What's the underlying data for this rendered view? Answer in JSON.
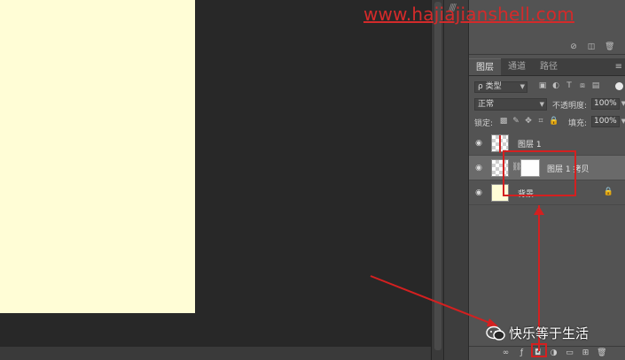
{
  "watermark": "www.hajiajianshell.com",
  "panel_tabs": [
    {
      "label": "图层",
      "active": true
    },
    {
      "label": "通道",
      "active": false
    },
    {
      "label": "路径",
      "active": false
    }
  ],
  "filter": {
    "value": "ρ 类型"
  },
  "blend_mode": {
    "value": "正常"
  },
  "opacity": {
    "label": "不透明度:",
    "value": "100%"
  },
  "lock": {
    "label": "锁定:"
  },
  "fill": {
    "label": "填充:",
    "value": "100%"
  },
  "layers": [
    {
      "name": "图层 1",
      "visible": true,
      "selected": false,
      "has_mask": false,
      "locked": false
    },
    {
      "name": "图层 1 拷贝",
      "visible": true,
      "selected": true,
      "has_mask": true,
      "locked": false
    },
    {
      "name": "背景",
      "visible": true,
      "selected": false,
      "has_mask": false,
      "locked": true
    }
  ],
  "wechat_label": "快乐等于生活",
  "colors": {
    "document": "#fffdd6",
    "annotation": "#d42020",
    "panel": "#535353",
    "canvas": "#282828"
  },
  "icons": {
    "filter": [
      "image-filter-icon",
      "adjust-filter-icon",
      "type-filter-icon",
      "shape-filter-icon",
      "smart-filter-icon"
    ],
    "lock": [
      "lock-pixels-icon",
      "lock-paint-icon",
      "lock-position-icon",
      "lock-artboard-icon",
      "lock-all-icon"
    ],
    "bottom": [
      "link-layers-icon",
      "fx-icon",
      "add-mask-icon",
      "adjustment-layer-icon",
      "new-group-icon",
      "new-layer-icon",
      "delete-layer-icon"
    ]
  }
}
